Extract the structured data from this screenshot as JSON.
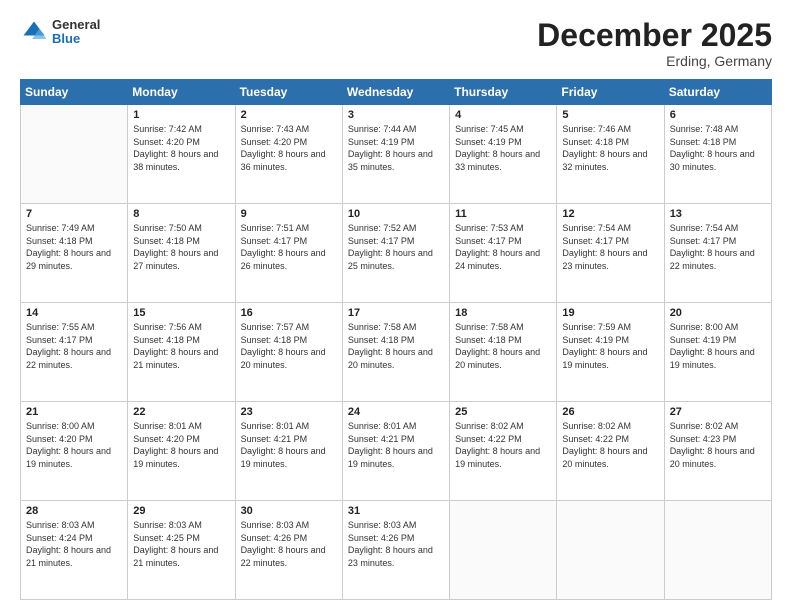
{
  "header": {
    "logo": {
      "general": "General",
      "blue": "Blue"
    },
    "title": "December 2025",
    "subtitle": "Erding, Germany"
  },
  "days_of_week": [
    "Sunday",
    "Monday",
    "Tuesday",
    "Wednesday",
    "Thursday",
    "Friday",
    "Saturday"
  ],
  "weeks": [
    [
      null,
      {
        "day": "1",
        "sunrise": "7:42 AM",
        "sunset": "4:20 PM",
        "daylight": "8 hours and 38 minutes."
      },
      {
        "day": "2",
        "sunrise": "7:43 AM",
        "sunset": "4:20 PM",
        "daylight": "8 hours and 36 minutes."
      },
      {
        "day": "3",
        "sunrise": "7:44 AM",
        "sunset": "4:19 PM",
        "daylight": "8 hours and 35 minutes."
      },
      {
        "day": "4",
        "sunrise": "7:45 AM",
        "sunset": "4:19 PM",
        "daylight": "8 hours and 33 minutes."
      },
      {
        "day": "5",
        "sunrise": "7:46 AM",
        "sunset": "4:18 PM",
        "daylight": "8 hours and 32 minutes."
      },
      {
        "day": "6",
        "sunrise": "7:48 AM",
        "sunset": "4:18 PM",
        "daylight": "8 hours and 30 minutes."
      }
    ],
    [
      {
        "day": "7",
        "sunrise": "7:49 AM",
        "sunset": "4:18 PM",
        "daylight": "8 hours and 29 minutes."
      },
      {
        "day": "8",
        "sunrise": "7:50 AM",
        "sunset": "4:18 PM",
        "daylight": "8 hours and 27 minutes."
      },
      {
        "day": "9",
        "sunrise": "7:51 AM",
        "sunset": "4:17 PM",
        "daylight": "8 hours and 26 minutes."
      },
      {
        "day": "10",
        "sunrise": "7:52 AM",
        "sunset": "4:17 PM",
        "daylight": "8 hours and 25 minutes."
      },
      {
        "day": "11",
        "sunrise": "7:53 AM",
        "sunset": "4:17 PM",
        "daylight": "8 hours and 24 minutes."
      },
      {
        "day": "12",
        "sunrise": "7:54 AM",
        "sunset": "4:17 PM",
        "daylight": "8 hours and 23 minutes."
      },
      {
        "day": "13",
        "sunrise": "7:54 AM",
        "sunset": "4:17 PM",
        "daylight": "8 hours and 22 minutes."
      }
    ],
    [
      {
        "day": "14",
        "sunrise": "7:55 AM",
        "sunset": "4:17 PM",
        "daylight": "8 hours and 22 minutes."
      },
      {
        "day": "15",
        "sunrise": "7:56 AM",
        "sunset": "4:18 PM",
        "daylight": "8 hours and 21 minutes."
      },
      {
        "day": "16",
        "sunrise": "7:57 AM",
        "sunset": "4:18 PM",
        "daylight": "8 hours and 20 minutes."
      },
      {
        "day": "17",
        "sunrise": "7:58 AM",
        "sunset": "4:18 PM",
        "daylight": "8 hours and 20 minutes."
      },
      {
        "day": "18",
        "sunrise": "7:58 AM",
        "sunset": "4:18 PM",
        "daylight": "8 hours and 20 minutes."
      },
      {
        "day": "19",
        "sunrise": "7:59 AM",
        "sunset": "4:19 PM",
        "daylight": "8 hours and 19 minutes."
      },
      {
        "day": "20",
        "sunrise": "8:00 AM",
        "sunset": "4:19 PM",
        "daylight": "8 hours and 19 minutes."
      }
    ],
    [
      {
        "day": "21",
        "sunrise": "8:00 AM",
        "sunset": "4:20 PM",
        "daylight": "8 hours and 19 minutes."
      },
      {
        "day": "22",
        "sunrise": "8:01 AM",
        "sunset": "4:20 PM",
        "daylight": "8 hours and 19 minutes."
      },
      {
        "day": "23",
        "sunrise": "8:01 AM",
        "sunset": "4:21 PM",
        "daylight": "8 hours and 19 minutes."
      },
      {
        "day": "24",
        "sunrise": "8:01 AM",
        "sunset": "4:21 PM",
        "daylight": "8 hours and 19 minutes."
      },
      {
        "day": "25",
        "sunrise": "8:02 AM",
        "sunset": "4:22 PM",
        "daylight": "8 hours and 19 minutes."
      },
      {
        "day": "26",
        "sunrise": "8:02 AM",
        "sunset": "4:22 PM",
        "daylight": "8 hours and 20 minutes."
      },
      {
        "day": "27",
        "sunrise": "8:02 AM",
        "sunset": "4:23 PM",
        "daylight": "8 hours and 20 minutes."
      }
    ],
    [
      {
        "day": "28",
        "sunrise": "8:03 AM",
        "sunset": "4:24 PM",
        "daylight": "8 hours and 21 minutes."
      },
      {
        "day": "29",
        "sunrise": "8:03 AM",
        "sunset": "4:25 PM",
        "daylight": "8 hours and 21 minutes."
      },
      {
        "day": "30",
        "sunrise": "8:03 AM",
        "sunset": "4:26 PM",
        "daylight": "8 hours and 22 minutes."
      },
      {
        "day": "31",
        "sunrise": "8:03 AM",
        "sunset": "4:26 PM",
        "daylight": "8 hours and 23 minutes."
      },
      null,
      null,
      null
    ]
  ],
  "labels": {
    "sunrise": "Sunrise:",
    "sunset": "Sunset:",
    "daylight": "Daylight:"
  }
}
